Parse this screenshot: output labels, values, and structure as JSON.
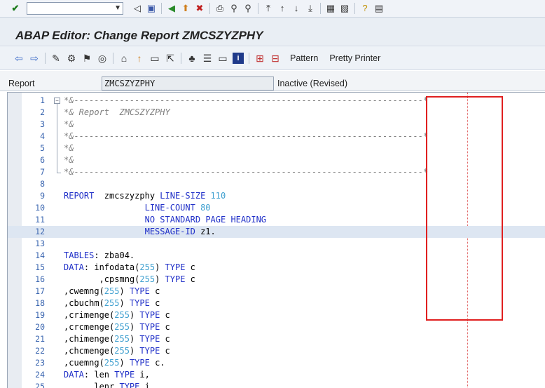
{
  "title": "ABAP Editor: Change Report ZMCSZYZPHY",
  "command_field": {
    "value": ""
  },
  "toolbar2": {
    "pattern_label": "Pattern",
    "pretty_printer_label": "Pretty Printer"
  },
  "report_row": {
    "label": "Report",
    "value": "ZMCSZYZPHY",
    "status": "Inactive (Revised)"
  },
  "lines": [
    {
      "n": "1",
      "t": "*&---------------------------------------------------------------------*"
    },
    {
      "n": "2",
      "t": "*& Report  ZMCSZYZPHY"
    },
    {
      "n": "3",
      "t": "*&"
    },
    {
      "n": "4",
      "t": "*&---------------------------------------------------------------------*"
    },
    {
      "n": "5",
      "t": "*&"
    },
    {
      "n": "6",
      "t": "*&"
    },
    {
      "n": "7",
      "t": "*&---------------------------------------------------------------------*"
    },
    {
      "n": "8",
      "t": ""
    },
    {
      "n": "9",
      "t": "REPORT  zmcszyzphy LINE-SIZE 110"
    },
    {
      "n": "10",
      "t": "                LINE-COUNT 80"
    },
    {
      "n": "11",
      "t": "                NO STANDARD PAGE HEADING"
    },
    {
      "n": "12",
      "t": "                MESSAGE-ID z1."
    },
    {
      "n": "13",
      "t": ""
    },
    {
      "n": "14",
      "t": "TABLES: zba04."
    },
    {
      "n": "15",
      "t": "DATA: infodata(255) TYPE c"
    },
    {
      "n": "16",
      "t": "       ,cpsmng(255) TYPE c"
    },
    {
      "n": "17",
      "t": ",cwemng(255) TYPE c"
    },
    {
      "n": "18",
      "t": ",cbuchm(255) TYPE c"
    },
    {
      "n": "19",
      "t": ",crimenge(255) TYPE c"
    },
    {
      "n": "20",
      "t": ",crcmenge(255) TYPE c"
    },
    {
      "n": "21",
      "t": ",chimenge(255) TYPE c"
    },
    {
      "n": "22",
      "t": ",chcmenge(255) TYPE c"
    },
    {
      "n": "23",
      "t": ",cuemng(255) TYPE c."
    },
    {
      "n": "24",
      "t": "DATA: len TYPE i,"
    },
    {
      "n": "25",
      "t": "      lenr TYPE i."
    }
  ],
  "highlight_line": "12"
}
